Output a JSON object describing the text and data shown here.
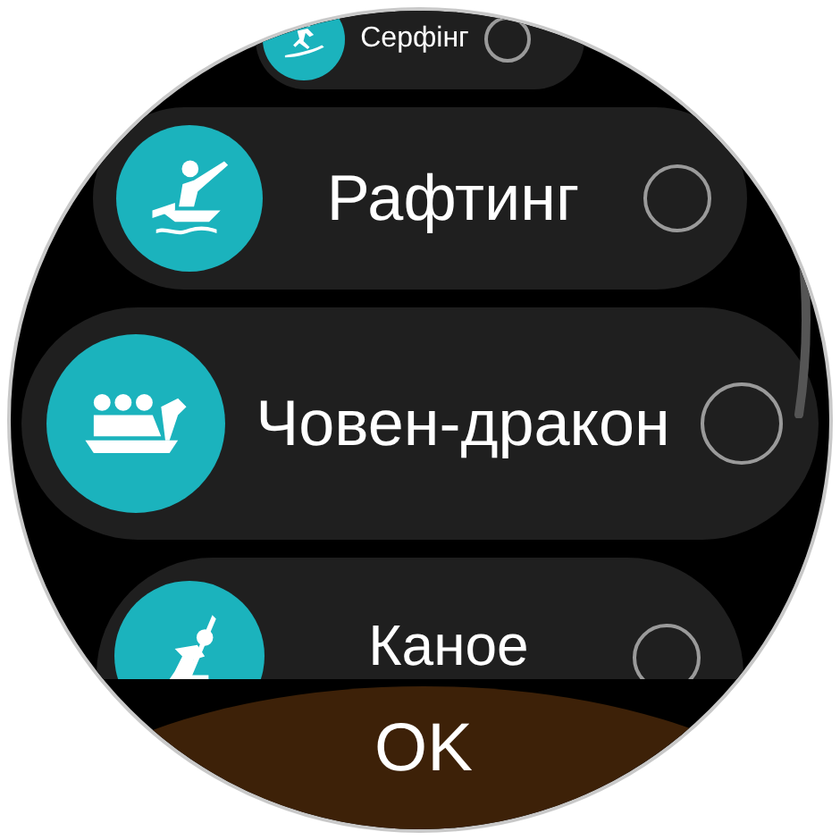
{
  "activities": [
    {
      "label": "Серфінг",
      "selected": false
    },
    {
      "label": "Рафтинг",
      "selected": false
    },
    {
      "label": "Човен-дракон",
      "selected": false
    },
    {
      "label": "Каное",
      "selected": false
    }
  ],
  "confirm_button": {
    "label": "OK"
  }
}
